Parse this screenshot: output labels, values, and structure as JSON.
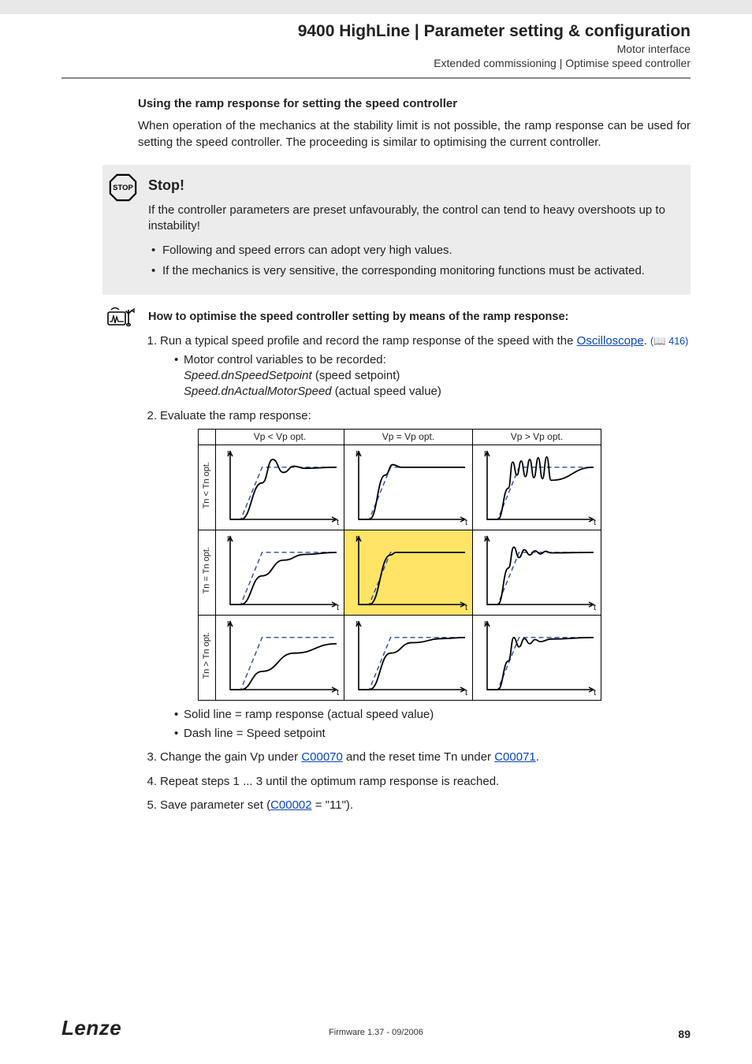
{
  "header": {
    "title": "9400 HighLine | Parameter setting & configuration",
    "sub1": "Motor interface",
    "sub2": "Extended commissioning | Optimise speed controller"
  },
  "section": {
    "heading": "Using the ramp response for setting the speed controller",
    "intro": "When operation of the mechanics at the stability limit is not possible, the ramp response can be used for setting the speed controller. The proceeding is similar to optimising the current controller."
  },
  "stopbox": {
    "title": "Stop!",
    "para": "If the controller parameters are preset unfavourably, the control can tend to heavy overshoots up to instability!",
    "bullets": [
      "Following and speed errors can adopt very high values.",
      "If the mechanics is very sensitive, the corresponding monitoring functions must be activated."
    ]
  },
  "howto": {
    "title": "How to optimise the speed controller setting by means of the ramp response:"
  },
  "steps": {
    "s1_pre": "Run a typical speed profile and record the ramp response of the speed with the ",
    "s1_link": "Oscilloscope",
    "s1_post": ".",
    "s1_ref_icon": "📖",
    "s1_ref": " 416)",
    "s1_ref_open": " (",
    "s1_sub_intro": "Motor control variables to be recorded:",
    "s1_sub_a_var": "Speed.dnSpeedSetpoint",
    "s1_sub_a_desc": " (speed setpoint)",
    "s1_sub_b_var": "Speed.dnActualMotorSpeed",
    "s1_sub_b_desc": " (actual speed value)",
    "s2": "Evaluate the ramp response:",
    "s3_pre": "Change the gain Vp under ",
    "s3_link1": "C00070",
    "s3_mid": " and the reset time Tn under ",
    "s3_link2": "C00071",
    "s3_post": ".",
    "s4": "Repeat steps 1 ... 3 until the optimum ramp response is reached.",
    "s5_pre": "Save parameter set (",
    "s5_link": "C00002",
    "s5_post": " = \"11\")."
  },
  "chart_labels": {
    "col1": "Vp < Vp opt.",
    "col2": "Vp = Vp opt.",
    "col3": "Vp > Vp opt.",
    "row1": "Tn < Tn opt.",
    "row2": "Tn = Tn opt.",
    "row3": "Tn > Tn opt.",
    "ylab": "n",
    "xlab": "t"
  },
  "legend": {
    "a": "Solid line = ramp response (actual speed value)",
    "b": "Dash line = Speed setpoint"
  },
  "footer": {
    "logo": "Lenze",
    "center": "Firmware 1.37 - 09/2006",
    "page": "89"
  },
  "chart_data": {
    "type": "line",
    "description": "3x3 grid of step-response sketches. Dashed line in every cell is the speed setpoint (ramp up then plateau). Solid line is actual speed. Columns vary proportional gain Vp (under-, optimum, over-). Rows vary integral reset time Tn (under-, optimum, over-). Optimum cell (row2,col2) is highlighted yellow.",
    "axes": {
      "x": "t (time, arbitrary units 0–10)",
      "y": "n (speed, normalized 0–1.2)"
    },
    "setpoint": {
      "x": [
        0,
        1,
        3,
        10
      ],
      "y": [
        0,
        0,
        1,
        1
      ]
    },
    "cells": [
      {
        "row": "Tn<Tn opt",
        "col": "Vp<Vp opt",
        "highlight": false,
        "actual": {
          "x": [
            0,
            1,
            3,
            4,
            5,
            6,
            7,
            10
          ],
          "y": [
            0,
            0,
            0.7,
            1.15,
            0.9,
            1.02,
            0.98,
            1.0
          ]
        }
      },
      {
        "row": "Tn<Tn opt",
        "col": "Vp=Vp opt",
        "highlight": false,
        "actual": {
          "x": [
            0,
            1,
            2.5,
            3.2,
            4,
            10
          ],
          "y": [
            0,
            0,
            0.85,
            1.05,
            1.0,
            1.0
          ]
        }
      },
      {
        "row": "Tn<Tn opt",
        "col": "Vp>Vp opt",
        "highlight": false,
        "actual": {
          "x": [
            0,
            1,
            2,
            2.4,
            2.8,
            3.2,
            3.6,
            4,
            4.4,
            4.8,
            5.2,
            5.6,
            6,
            10
          ],
          "y": [
            0,
            0,
            0.6,
            1.1,
            0.85,
            1.12,
            0.82,
            1.15,
            0.8,
            1.18,
            0.78,
            1.2,
            0.75,
            1.0
          ]
        }
      },
      {
        "row": "Tn=Tn opt",
        "col": "Vp<Vp opt",
        "highlight": false,
        "actual": {
          "x": [
            0,
            1,
            3,
            5,
            7,
            10
          ],
          "y": [
            0,
            0,
            0.55,
            0.85,
            0.96,
            1.0
          ]
        }
      },
      {
        "row": "Tn=Tn opt",
        "col": "Vp=Vp opt",
        "highlight": true,
        "actual": {
          "x": [
            0,
            1,
            3,
            3.5,
            10
          ],
          "y": [
            0,
            0,
            0.95,
            1.0,
            1.0
          ]
        }
      },
      {
        "row": "Tn=Tn opt",
        "col": "Vp>Vp opt",
        "highlight": false,
        "actual": {
          "x": [
            0,
            1,
            2,
            2.5,
            3,
            3.5,
            4,
            4.5,
            5,
            5.5,
            6,
            10
          ],
          "y": [
            0,
            0,
            0.7,
            1.1,
            0.9,
            1.05,
            0.95,
            1.03,
            0.97,
            1.02,
            0.99,
            1.0
          ]
        }
      },
      {
        "row": "Tn>Tn opt",
        "col": "Vp<Vp opt",
        "highlight": false,
        "actual": {
          "x": [
            0,
            1,
            3,
            6,
            10
          ],
          "y": [
            0,
            0,
            0.35,
            0.7,
            0.88
          ]
        }
      },
      {
        "row": "Tn>Tn opt",
        "col": "Vp=Vp opt",
        "highlight": false,
        "actual": {
          "x": [
            0,
            1,
            3,
            5,
            8,
            10
          ],
          "y": [
            0,
            0,
            0.7,
            0.9,
            0.98,
            1.0
          ]
        }
      },
      {
        "row": "Tn>Tn opt",
        "col": "Vp>Vp opt",
        "highlight": false,
        "actual": {
          "x": [
            0,
            1,
            2,
            2.5,
            3,
            3.5,
            4,
            4.5,
            5,
            6,
            10
          ],
          "y": [
            0,
            0,
            0.55,
            1.0,
            0.82,
            0.98,
            0.88,
            0.96,
            0.92,
            0.97,
            1.0
          ]
        }
      }
    ]
  }
}
